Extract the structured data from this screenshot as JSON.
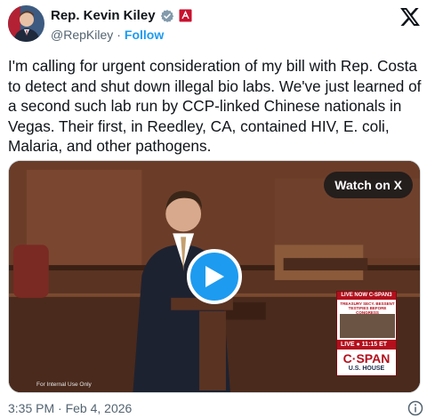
{
  "header": {
    "display_name": "Rep. Kevin Kiley",
    "handle": "@RepKiley",
    "separator": "·",
    "follow_label": "Follow",
    "avatar_icon": "profile-photo",
    "verified_icon": "government-verified-badge",
    "flag_icon": "us-congress-flag",
    "brand_icon": "x-logo"
  },
  "tweet": {
    "text": "I'm calling for urgent consideration of my bill with Rep. Costa to detect and shut down illegal bio labs. We've just learned of a second such lab run by CCP-linked Chinese nationals in Vegas. Their first, in Reedley, CA, contained HIV, E. coli, Malaria, and other pathogens."
  },
  "media": {
    "watch_label": "Watch on X",
    "play_icon": "play-icon",
    "internal_use": "For Internal Use Only",
    "cspan": {
      "top_label": "LIVE NOW C-SPAN3",
      "subtitle": "TREASURY SECY. BESSENT TESTIFIES BEFORE CONGRESS",
      "live_label": "LIVE ● 11:15 ET",
      "logo": "C·SPAN",
      "house": "U.S. HOUSE"
    }
  },
  "footer": {
    "timestamp": "3:35 PM · Feb 4, 2026",
    "info_icon": "info-icon"
  },
  "colors": {
    "accent": "#1d9bf0",
    "text": "#0f1419",
    "muted": "#536471",
    "cspan_red": "#b40f1c"
  }
}
